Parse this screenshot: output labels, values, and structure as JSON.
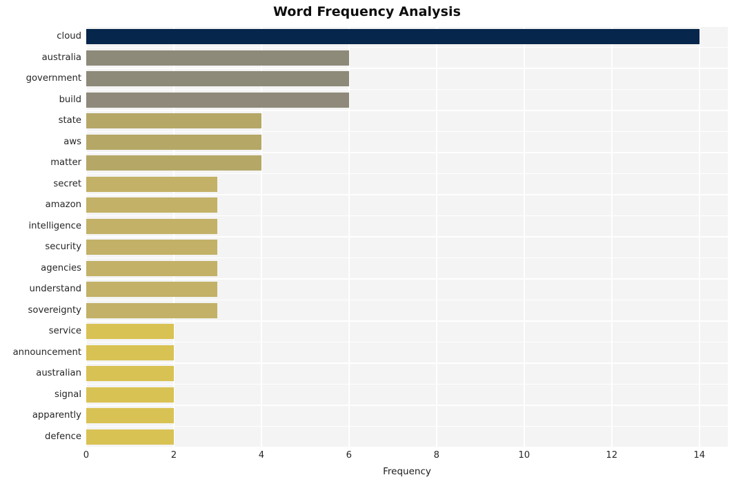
{
  "chart_data": {
    "type": "bar",
    "orientation": "horizontal",
    "title": "Word Frequency Analysis",
    "xlabel": "Frequency",
    "ylabel": "",
    "categories": [
      "cloud",
      "australia",
      "government",
      "build",
      "state",
      "aws",
      "matter",
      "secret",
      "amazon",
      "intelligence",
      "security",
      "agencies",
      "understand",
      "sovereignty",
      "service",
      "announcement",
      "australian",
      "signal",
      "apparently",
      "defence"
    ],
    "values": [
      14,
      6,
      6,
      6,
      4,
      4,
      4,
      3,
      3,
      3,
      3,
      3,
      3,
      3,
      2,
      2,
      2,
      2,
      2,
      2
    ],
    "bar_colors": [
      "#06264b",
      "#8e8a7a",
      "#8e8a7a",
      "#8e897a",
      "#b5a867",
      "#b5a867",
      "#b5a867",
      "#c2b167",
      "#c2b167",
      "#c2b167",
      "#c2b167",
      "#c2b167",
      "#c2b167",
      "#c2b167",
      "#d9c254",
      "#d9c254",
      "#d9c254",
      "#d9c254",
      "#d9c254",
      "#d9c254"
    ],
    "xticks": [
      0,
      2,
      4,
      6,
      8,
      10,
      12,
      14
    ],
    "xlim": [
      0,
      14.65
    ],
    "grid": true,
    "grid_color": "#ffffff",
    "plot_background": "#f4f4f4",
    "figure_background": "#ffffff",
    "legend": null
  }
}
